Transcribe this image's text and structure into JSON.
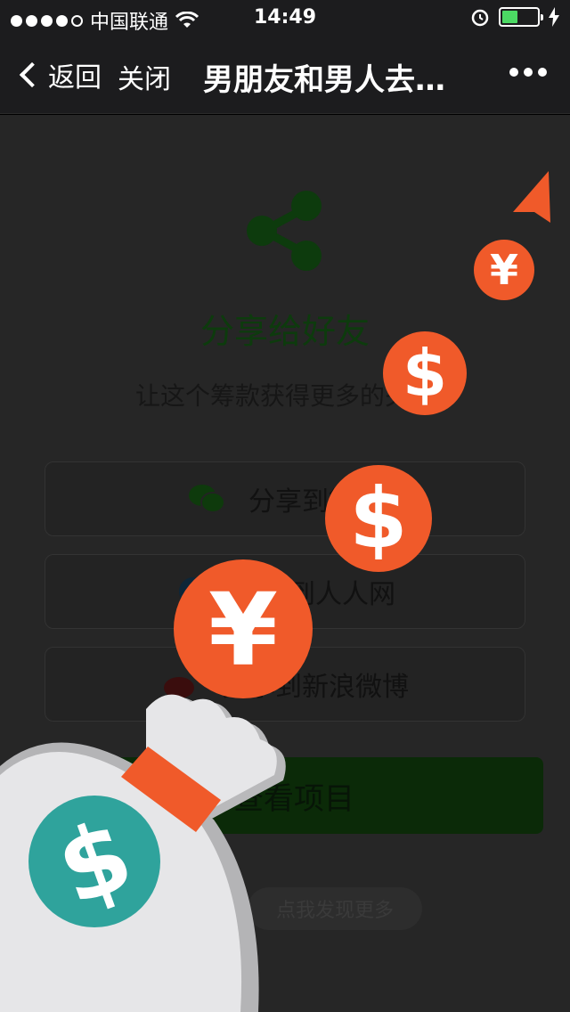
{
  "status_bar": {
    "carrier": "中国联通",
    "time": "14:49"
  },
  "nav": {
    "back_label": "返回",
    "close_label": "关闭",
    "title": "男朋友和男人去…"
  },
  "share": {
    "title": "分享给好友",
    "subtitle": "让这个筹款获得更多的关注",
    "options": [
      {
        "label": "分享到微信",
        "icon": "wechat-icon"
      },
      {
        "label": "分享到人人网",
        "icon": "renren-icon"
      },
      {
        "label": "分享到新浪微博",
        "icon": "weibo-icon"
      }
    ]
  },
  "view_project_label": "查看项目",
  "discover_more_label": "点我发现更多",
  "overlay": {
    "coin_symbols": [
      "¥",
      "$",
      "$",
      "¥"
    ],
    "bag_symbol": "$"
  },
  "colors": {
    "accent_orange": "#f05a2a",
    "teal": "#2fa39c",
    "share_green": "#0d3b0d"
  }
}
